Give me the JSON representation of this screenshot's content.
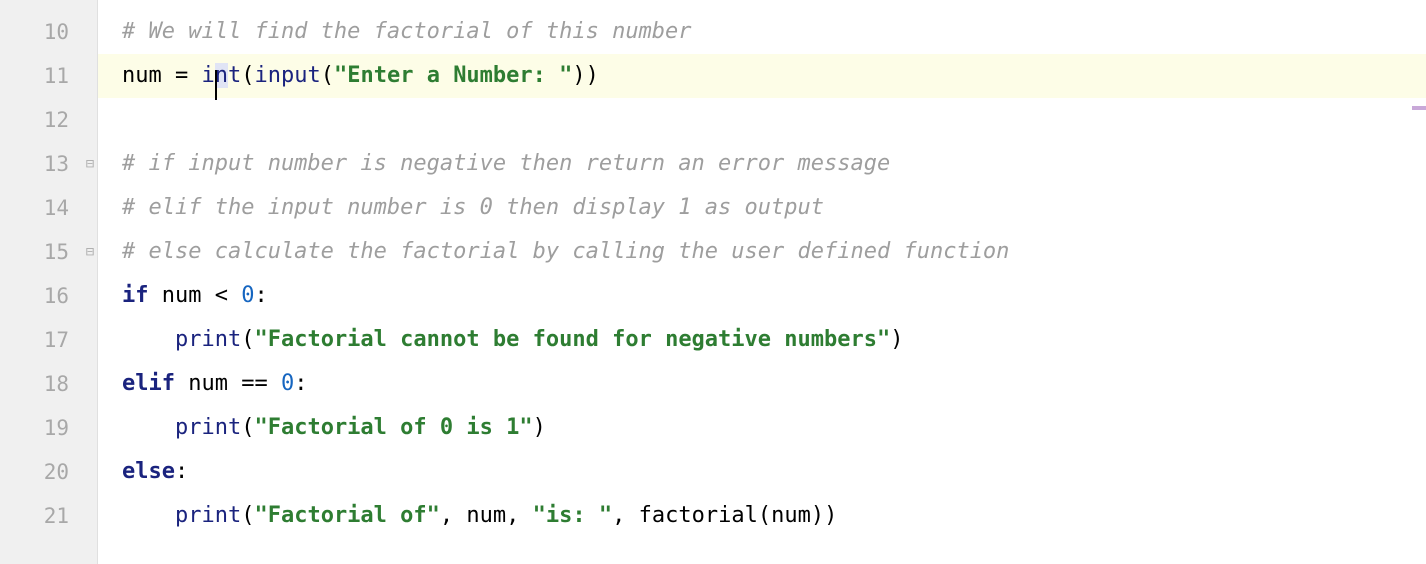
{
  "lines": {
    "start": 10,
    "numbers": [
      "10",
      "11",
      "12",
      "13",
      "14",
      "15",
      "16",
      "17",
      "18",
      "19",
      "20",
      "21"
    ]
  },
  "code": {
    "l10_comment": "# We will find the factorial of this number",
    "l11_num": "num",
    "l11_eq": " = ",
    "l11_int_i": "i",
    "l11_int_n": "n",
    "l11_int_t": "t",
    "l11_paren1": "(",
    "l11_input": "input",
    "l11_paren2": "(",
    "l11_str": "\"Enter a Number: \"",
    "l11_paren3": "))",
    "l13_comment": "# if input number is negative then return an error message",
    "l14_comment": "# elif the input number is 0 then display 1 as output",
    "l15_comment": "# else calculate the factorial by calling the user defined function",
    "l16_if": "if",
    "l16_sp1": " ",
    "l16_num": "num ",
    "l16_lt": "< ",
    "l16_zero": "0",
    "l16_colon": ":",
    "l17_indent": "    ",
    "l17_print": "print",
    "l17_paren1": "(",
    "l17_str": "\"Factorial cannot be found for negative numbers\"",
    "l17_paren2": ")",
    "l18_elif": "elif",
    "l18_sp1": " ",
    "l18_num": "num ",
    "l18_eq": "== ",
    "l18_zero": "0",
    "l18_colon": ":",
    "l19_indent": "    ",
    "l19_print": "print",
    "l19_paren1": "(",
    "l19_str": "\"Factorial of 0 is 1\"",
    "l19_paren2": ")",
    "l20_else": "else",
    "l20_colon": ":",
    "l21_indent": "    ",
    "l21_print": "print",
    "l21_paren1": "(",
    "l21_str1": "\"Factorial of\"",
    "l21_comma1": ", ",
    "l21_num": "num",
    "l21_comma2": ", ",
    "l21_str2": "\"is: \"",
    "l21_comma3": ", ",
    "l21_fact": "factorial(num))"
  }
}
